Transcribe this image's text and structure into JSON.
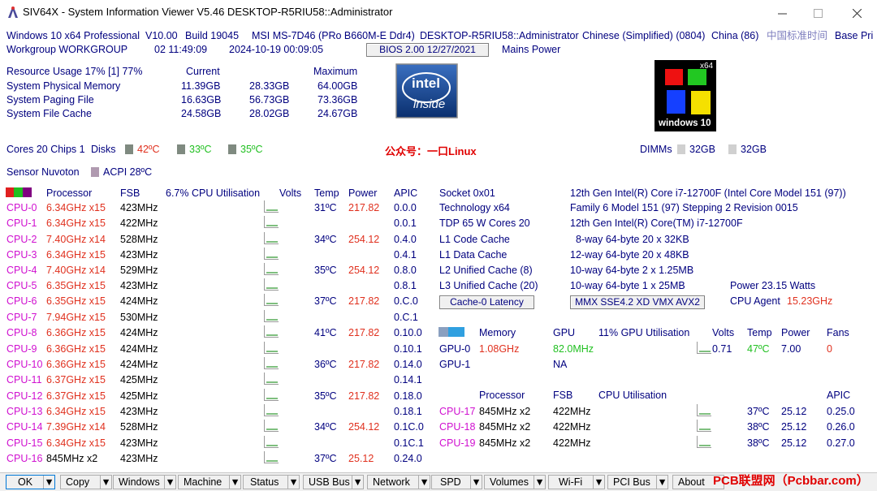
{
  "window": {
    "title": "SIV64X - System Information Viewer V5.46 DESKTOP-R5RIU58::Administrator"
  },
  "info": {
    "os": "Windows 10 x64 Professional",
    "version": "V10.00",
    "build": "Build 19045",
    "board": "MSI MS-7D46 (PRo B660M-E Ddr4)",
    "user": "DESKTOP-R5RIU58::Administrator",
    "lang": "Chinese (Simplified) (0804)",
    "country": "China (86)",
    "tz": "中国标准时间",
    "basepri": "Base Pri",
    "workgroup": "Workgroup WORKGROUP",
    "uptime": "02 11:49:09",
    "datetime": "2024-10-19 00:09:05",
    "bios": "BIOS 2.00 12/27/2021",
    "mains": "Mains Power"
  },
  "resource": {
    "header": "Resource Usage 17% [1] 77%",
    "current": "Current",
    "maximum": "Maximum",
    "rows": [
      {
        "label": "System Physical Memory",
        "a": "11.39GB",
        "b": "28.33GB",
        "c": "64.00GB"
      },
      {
        "label": "System Paging File",
        "a": "16.63GB",
        "b": "56.73GB",
        "c": "73.36GB"
      },
      {
        "label": "System File Cache",
        "a": "24.58GB",
        "b": "28.02GB",
        "c": "24.67GB"
      }
    ]
  },
  "logos": {
    "intel_top": "intel",
    "intel_bottom": "inside",
    "win_badge": "x64",
    "win_text": "windows 10"
  },
  "cores": {
    "text": "Cores 20 Chips 1",
    "disks": "Disks",
    "d1": "42ºC",
    "d2": "33ºC",
    "d3": "35ºC",
    "promo": "公众号：一口Linux",
    "dimms": "DIMMs",
    "m1": "32GB",
    "m2": "32GB",
    "sensor": "Sensor Nuvoton",
    "acpi": "ACPI 28ºC"
  },
  "cpu_table": {
    "headers": {
      "processor": "Processor",
      "fsb": "FSB",
      "util": "6.7% CPU Utilisation",
      "volts": "Volts",
      "temp": "Temp",
      "power": "Power",
      "apic": "APIC"
    },
    "rows": [
      {
        "name": "CPU-0",
        "freq": "6.34GHz x15",
        "fsb": "423MHz",
        "temp": "31ºC",
        "power": "217.82",
        "apic": "0.0.0"
      },
      {
        "name": "CPU-1",
        "freq": "6.34GHz x15",
        "fsb": "422MHz",
        "temp": "",
        "power": "",
        "apic": "0.0.1"
      },
      {
        "name": "CPU-2",
        "freq": "7.40GHz x14",
        "fsb": "528MHz",
        "temp": "34ºC",
        "power": "254.12",
        "apic": "0.4.0"
      },
      {
        "name": "CPU-3",
        "freq": "6.34GHz x15",
        "fsb": "423MHz",
        "temp": "",
        "power": "",
        "apic": "0.4.1"
      },
      {
        "name": "CPU-4",
        "freq": "7.40GHz x14",
        "fsb": "529MHz",
        "temp": "35ºC",
        "power": "254.12",
        "apic": "0.8.0"
      },
      {
        "name": "CPU-5",
        "freq": "6.35GHz x15",
        "fsb": "423MHz",
        "temp": "",
        "power": "",
        "apic": "0.8.1"
      },
      {
        "name": "CPU-6",
        "freq": "6.35GHz x15",
        "fsb": "424MHz",
        "temp": "37ºC",
        "power": "217.82",
        "apic": "0.C.0"
      },
      {
        "name": "CPU-7",
        "freq": "7.94GHz x15",
        "fsb": "530MHz",
        "temp": "",
        "power": "",
        "apic": "0.C.1"
      },
      {
        "name": "CPU-8",
        "freq": "6.36GHz x15",
        "fsb": "424MHz",
        "temp": "41ºC",
        "power": "217.82",
        "apic": "0.10.0"
      },
      {
        "name": "CPU-9",
        "freq": "6.36GHz x15",
        "fsb": "424MHz",
        "temp": "",
        "power": "",
        "apic": "0.10.1"
      },
      {
        "name": "CPU-10",
        "freq": "6.36GHz x15",
        "fsb": "424MHz",
        "temp": "36ºC",
        "power": "217.82",
        "apic": "0.14.0"
      },
      {
        "name": "CPU-11",
        "freq": "6.37GHz x15",
        "fsb": "425MHz",
        "temp": "",
        "power": "",
        "apic": "0.14.1"
      },
      {
        "name": "CPU-12",
        "freq": "6.37GHz x15",
        "fsb": "425MHz",
        "temp": "35ºC",
        "power": "217.82",
        "apic": "0.18.0"
      },
      {
        "name": "CPU-13",
        "freq": "6.34GHz x15",
        "fsb": "423MHz",
        "temp": "",
        "power": "",
        "apic": "0.18.1"
      },
      {
        "name": "CPU-14",
        "freq": "7.39GHz x14",
        "fsb": "528MHz",
        "temp": "34ºC",
        "power": "254.12",
        "apic": "0.1C.0"
      },
      {
        "name": "CPU-15",
        "freq": "6.34GHz x15",
        "fsb": "423MHz",
        "temp": "",
        "power": "",
        "apic": "0.1C.1"
      },
      {
        "name": "CPU-16",
        "freq": "845MHz x2",
        "fsb": "423MHz",
        "temp": "37ºC",
        "power": "25.12",
        "apic": "0.24.0"
      }
    ]
  },
  "cpu_info": {
    "socket": "Socket 0x01",
    "cpu_name": "12th Gen Intel(R) Core i7-12700F (Intel Core Model 151 (97))",
    "tech": "Technology  x64",
    "family": "Family 6  Model 151 (97)  Stepping 2  Revision 0015",
    "tdp": "TDP 65 W Cores 20",
    "brand": "12th Gen Intel(R) Core(TM) i7-12700F",
    "l1c": "L1 Code Cache",
    "l1c_v": "8-way 64-byte  20 x 32KB",
    "l1d": "L1 Data Cache",
    "l1d_v": "12-way 64-byte  20 x 48KB",
    "l2": "L2 Unified Cache (8)",
    "l2_v": "10-way 64-byte  2 x 1.25MB",
    "l3": "L3 Unified Cache (20)",
    "l3_v": "10-way 64-byte  1 x 25MB",
    "power_label": "Power  23.15 Watts",
    "cache_btn": "Cache-0 Latency",
    "isa_btn": "MMX SSE4.2 XD VMX AVX2",
    "agent_label": "CPU Agent",
    "agent_value": "15.23GHz"
  },
  "gpu": {
    "headers": {
      "memory": "Memory",
      "gpu": "GPU",
      "util": "11% GPU Utilisation",
      "volts": "Volts",
      "temp": "Temp",
      "power": "Power",
      "fans": "Fans"
    },
    "g0": {
      "name": "GPU-0",
      "mem": "1.08GHz",
      "clk": "82.0MHz",
      "volts": "0.71",
      "temp": "47ºC",
      "power": "7.00",
      "fans": "0"
    },
    "g1": {
      "name": "GPU-1",
      "clk": "NA"
    }
  },
  "cpu_ext": {
    "headers": {
      "processor": "Processor",
      "fsb": "FSB",
      "util": "CPU Utilisation",
      "apic": "APIC"
    },
    "rows": [
      {
        "name": "CPU-17",
        "freq": "845MHz x2",
        "fsb": "422MHz",
        "temp": "37ºC",
        "power": "25.12",
        "apic": "0.25.0"
      },
      {
        "name": "CPU-18",
        "freq": "845MHz x2",
        "fsb": "422MHz",
        "temp": "38ºC",
        "power": "25.12",
        "apic": "0.26.0"
      },
      {
        "name": "CPU-19",
        "freq": "845MHz x2",
        "fsb": "422MHz",
        "temp": "38ºC",
        "power": "25.12",
        "apic": "0.27.0"
      }
    ]
  },
  "toolbar": {
    "ok": "OK",
    "copy": "Copy",
    "windows": "Windows",
    "machine": "Machine",
    "status": "Status",
    "usb": "USB Bus",
    "network": "Network",
    "spd": "SPD",
    "volumes": "Volumes",
    "wifi": "Wi-Fi",
    "pci": "PCI Bus",
    "about": "About"
  },
  "watermark": "PCB联盟网（Pcbbar.com）"
}
